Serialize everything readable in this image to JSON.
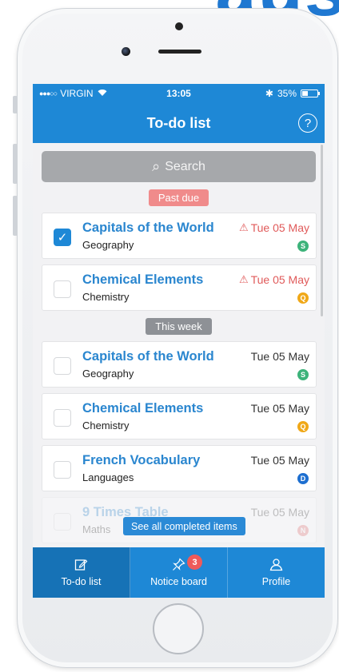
{
  "brand": {
    "text": "aus"
  },
  "status_bar": {
    "signal": "●●●○○",
    "carrier": "VIRGIN",
    "time": "13:05",
    "bluetooth": "✱",
    "battery": "35%",
    "battery_level": 0.35
  },
  "nav": {
    "title": "To-do list",
    "help_icon": "?"
  },
  "search": {
    "placeholder": "Search",
    "icon": "⌕"
  },
  "sections": {
    "past_due": "Past due",
    "this_week": "This week"
  },
  "tasks": [
    {
      "title": "Capitals of the World",
      "subject": "Geography",
      "date": "Tue 05 May",
      "overdue": true,
      "checked": true,
      "badge": "S",
      "badge_color": "#3db37a"
    },
    {
      "title": "Chemical Elements",
      "subject": "Chemistry",
      "date": "Tue 05 May",
      "overdue": true,
      "checked": false,
      "badge": "Q",
      "badge_color": "#f0a818"
    },
    {
      "title": "Capitals of the World",
      "subject": "Geography",
      "date": "Tue 05 May",
      "overdue": false,
      "checked": false,
      "badge": "S",
      "badge_color": "#3db37a"
    },
    {
      "title": "Chemical Elements",
      "subject": "Chemistry",
      "date": "Tue 05 May",
      "overdue": false,
      "checked": false,
      "badge": "Q",
      "badge_color": "#f0a818"
    },
    {
      "title": "French Vocabulary",
      "subject": "Languages",
      "date": "Tue 05 May",
      "overdue": false,
      "checked": false,
      "badge": "D",
      "badge_color": "#1e6fd0"
    },
    {
      "title": "9 Times Table",
      "subject": "Maths",
      "date": "Tue 05 May",
      "overdue": false,
      "checked": false,
      "badge": "N",
      "badge_color": "#e36a6a"
    }
  ],
  "see_all": "See all completed items",
  "tabs": [
    {
      "label": "To-do list",
      "icon": "✎"
    },
    {
      "label": "Notice board",
      "icon": "⚲",
      "badge": "3"
    },
    {
      "label": "Profile",
      "icon": "⚇"
    }
  ],
  "colors": {
    "accent": "#1e88d6",
    "overdue": "#e05a5a",
    "badge_red": "#ee5a5a"
  }
}
